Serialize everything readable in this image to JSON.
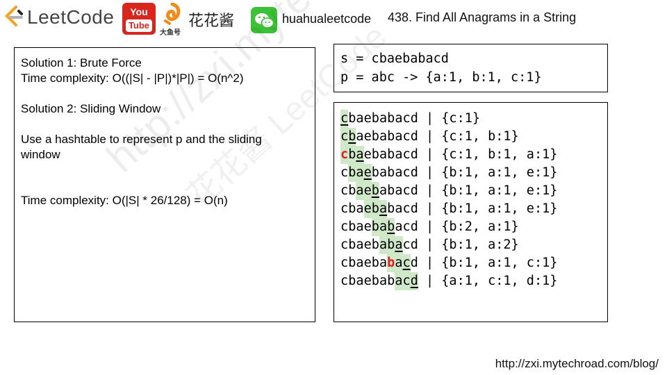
{
  "header": {
    "leetcode_text": "LeetCode",
    "youtube_top": "You",
    "youtube_bottom": "Tube",
    "fish_sub": "大鱼号",
    "chinese_name": "花花酱",
    "wechat_handle": "huahualeetcode",
    "problem_title": "438. Find All Anagrams in a String"
  },
  "colors": {
    "youtube_red": "#d8261f",
    "wechat_green": "#3bc236",
    "highlight_green": "#cfe8c8",
    "red_char": "#e02020"
  },
  "notes": {
    "lines": [
      "Solution 1: Brute Force",
      "Time complexity: O((|S| - |P|)*|P|) = O(n^2)",
      "Solution 2: Sliding Window",
      "Use a hashtable to represent p and the sliding",
      "window",
      "Time complexity: O(|S| * 26/128) = O(n)"
    ]
  },
  "example": {
    "s_line": "s = cbaebabacd",
    "p_line": "p = abc -> {a:1, b:1, c:1}"
  },
  "window": {
    "string": "cbaebabacd",
    "rows": [
      {
        "start": 0,
        "end": 0,
        "red": -1,
        "map": " | {c:1}"
      },
      {
        "start": 0,
        "end": 1,
        "red": -1,
        "map": " | {c:1, b:1}"
      },
      {
        "start": 0,
        "end": 2,
        "red": 0,
        "map": " | {c:1, b:1, a:1}"
      },
      {
        "start": 1,
        "end": 3,
        "red": -1,
        "map": " | {b:1, a:1, e:1}"
      },
      {
        "start": 2,
        "end": 4,
        "red": -1,
        "map": " | {b:1, a:1, e:1}"
      },
      {
        "start": 3,
        "end": 5,
        "red": -1,
        "map": " | {b:1, a:1, e:1}"
      },
      {
        "start": 4,
        "end": 6,
        "red": -1,
        "map": " | {b:2, a:1}"
      },
      {
        "start": 5,
        "end": 7,
        "red": -1,
        "map": " | {b:1, a:2}"
      },
      {
        "start": 6,
        "end": 8,
        "red": 6,
        "map": " | {b:1, a:1, c:1}"
      },
      {
        "start": 7,
        "end": 9,
        "red": -1,
        "map": " | {a:1, c:1, d:1}"
      }
    ]
  },
  "watermark": {
    "text1": "http://zxi.mytechroad.com/blog/",
    "text2": "花花酱 LeetCode"
  },
  "footer": {
    "url": "http://zxi.mytechroad.com/blog/"
  }
}
